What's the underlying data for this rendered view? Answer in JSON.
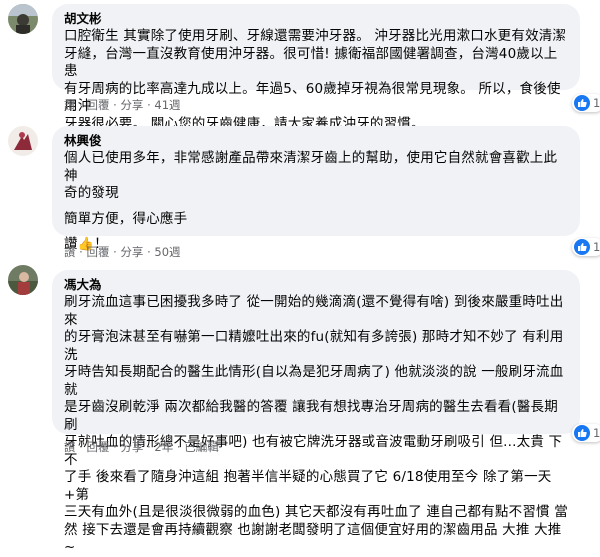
{
  "comments": [
    {
      "author": "胡文彬",
      "lines": [
        "口腔衛生 其實除了使用牙刷、牙線還需要沖牙器。 沖牙器比光用漱口水更有效清潔",
        "牙縫，台灣一直沒教育使用沖牙器。很可惜! 據衛福部國健署調查，台灣40歲以上患",
        "有牙周病的比率高達九成以上。年過5、60歲掉牙視為很常見現象。 所以，食後使用沖",
        "牙器很必要。 關心您的牙齒健康，請大家養成沖牙的習慣。"
      ],
      "actions": {
        "like": "讚",
        "reply": "回覆",
        "share": "分享",
        "time": "41週"
      },
      "reaction_count": "1"
    },
    {
      "author": "林興俊",
      "paragraphs": [
        "個人已使用多年，非常感謝產品帶來清潔牙齒上的幫助，使用它自然就會喜歡上此神",
        "奇的發現",
        "簡單方便，得心應手",
        "讚",
        "！"
      ],
      "actions": {
        "like": "讚",
        "reply": "回覆",
        "share": "分享",
        "time": "50週"
      },
      "reaction_count": "1"
    },
    {
      "author": "馮大為",
      "lines": [
        "刷牙流血這事已困擾我多時了 從一開始的幾滴滴(還不覺得有啥) 到後來嚴重時吐出來",
        "的牙膏泡沫甚至有嚇第一口精嬤吐出來的fu(就知有多誇張) 那時才知不妙了 有利用洗",
        "牙時告知長期配合的醫生此情形(自以為是犯牙周病了) 他就淡淡的說 一般刷牙流血就",
        "是牙齒沒刷乾淨 兩次都給我醫的答覆 讓我有想找專治牙周病的醫生去看看(醫長期刷",
        "牙就吐血的情形總不是好事吧) 也有被它牌洗牙器或音波電動牙刷吸引 但...太貴 下不",
        "了手 後來看了隨身沖這組 抱著半信半疑的心態買了它 6/18使用至今 除了第一天 +第",
        "三天有血外(且是很淡很微弱的血色) 其它天都沒有再吐血了 連自己都有點不習慣 當",
        "然 接下去還是會再持續觀察 也謝謝老闆發明了這個便宜好用的潔齒用品 大推 大推~"
      ],
      "actions": {
        "like": "讚",
        "reply": "回覆",
        "share": "分享",
        "time": "2年",
        "edited": "已編輯"
      },
      "reaction_count": "1"
    }
  ],
  "colors": {
    "bubble": "#f0f2f5",
    "like": "#1877f2",
    "meta": "#65676b"
  },
  "icons": {
    "like": "thumbs-up-icon",
    "clap": "thumbs-up-emoji"
  }
}
